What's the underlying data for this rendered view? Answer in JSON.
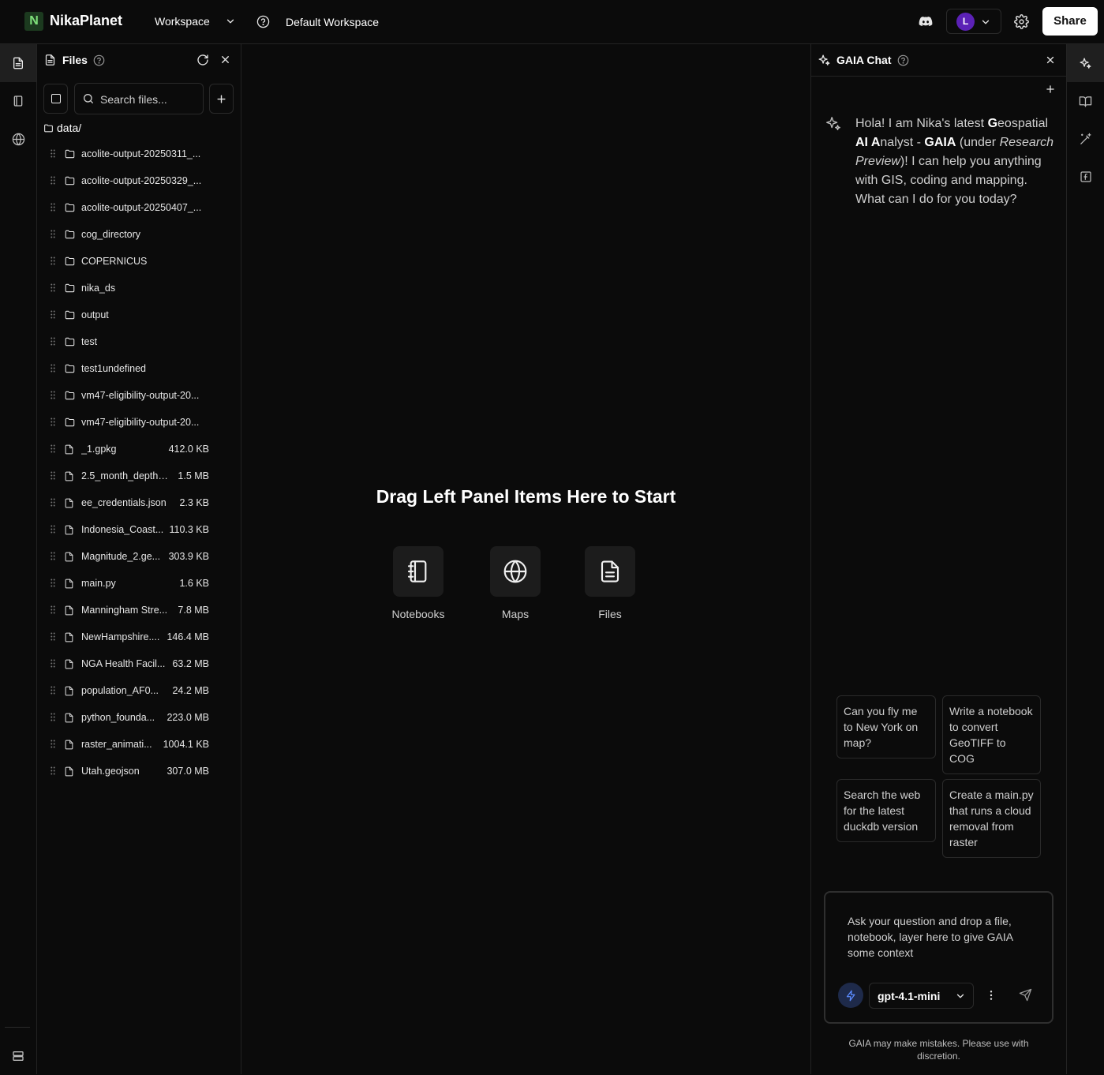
{
  "app": {
    "name": "NikaPlanet",
    "logo_letter": "N"
  },
  "topbar": {
    "workspace_label": "Workspace",
    "workspace_name": "Default Workspace",
    "user_initial": "L",
    "share_label": "Share"
  },
  "files": {
    "title": "Files",
    "search_placeholder": "Search files...",
    "root": "data/",
    "items": [
      {
        "type": "folder",
        "name": "acolite-output-20250311_...",
        "size": ""
      },
      {
        "type": "folder",
        "name": "acolite-output-20250329_...",
        "size": ""
      },
      {
        "type": "folder",
        "name": "acolite-output-20250407_...",
        "size": ""
      },
      {
        "type": "folder",
        "name": "cog_directory",
        "size": ""
      },
      {
        "type": "folder",
        "name": "COPERNICUS",
        "size": ""
      },
      {
        "type": "folder",
        "name": "nika_ds",
        "size": ""
      },
      {
        "type": "folder",
        "name": "output",
        "size": ""
      },
      {
        "type": "folder",
        "name": "test",
        "size": ""
      },
      {
        "type": "folder",
        "name": "test1undefined",
        "size": ""
      },
      {
        "type": "folder",
        "name": "vm47-eligibility-output-20...",
        "size": ""
      },
      {
        "type": "folder",
        "name": "vm47-eligibility-output-20...",
        "size": ""
      },
      {
        "type": "file",
        "name": "_1.gpkg",
        "size": "412.0 KB"
      },
      {
        "type": "file",
        "name": "2.5_month_depth....",
        "size": "1.5 MB"
      },
      {
        "type": "file",
        "name": "ee_credentials.json",
        "size": "2.3 KB"
      },
      {
        "type": "file",
        "name": "Indonesia_Coast...",
        "size": "110.3 KB"
      },
      {
        "type": "file",
        "name": "Magnitude_2.ge...",
        "size": "303.9 KB"
      },
      {
        "type": "file",
        "name": "main.py",
        "size": "1.6 KB"
      },
      {
        "type": "file",
        "name": "Manningham Stre...",
        "size": "7.8 MB"
      },
      {
        "type": "file",
        "name": "NewHampshire....",
        "size": "146.4 MB"
      },
      {
        "type": "file",
        "name": "NGA Health Facil...",
        "size": "63.2 MB"
      },
      {
        "type": "file",
        "name": "population_AF0...",
        "size": "24.2 MB"
      },
      {
        "type": "file",
        "name": "python_founda...",
        "size": "223.0 MB"
      },
      {
        "type": "file",
        "name": "raster_animati...",
        "size": "1004.1 KB"
      },
      {
        "type": "file",
        "name": "Utah.geojson",
        "size": "307.0 MB"
      }
    ]
  },
  "main": {
    "title": "Drag Left Panel Items Here to Start",
    "tiles": [
      {
        "label": "Notebooks",
        "icon": "notebook-icon"
      },
      {
        "label": "Maps",
        "icon": "globe-icon"
      },
      {
        "label": "Files",
        "icon": "file-icon"
      }
    ]
  },
  "chat": {
    "title": "GAIA Chat",
    "greeting": {
      "t1": "Hola! I am Nika's latest ",
      "b1": "G",
      "t2": "eospatial ",
      "b2": "AI A",
      "t3": "nalyst - ",
      "b3": "GAIA",
      "t4": " (under ",
      "i1": "Research Preview",
      "t5": ")! I can help you anything with GIS, coding and mapping. What can I do for you today?"
    },
    "suggestions": [
      "Can you fly me to New York on map?",
      "Write a notebook to convert GeoTIFF to COG",
      "Search the web for the latest duckdb version",
      "Create a main.py that runs a cloud removal from raster"
    ],
    "input_placeholder": "Ask your question and drop a file, notebook, layer here to give GAIA some context",
    "model": "gpt-4.1-mini",
    "disclaimer": "GAIA may make mistakes. Please use with discretion."
  },
  "colors": {
    "accent_avatar": "#5b21b6",
    "logo_bg": "#1c3a1f",
    "logo_fg": "#7ee07a"
  }
}
